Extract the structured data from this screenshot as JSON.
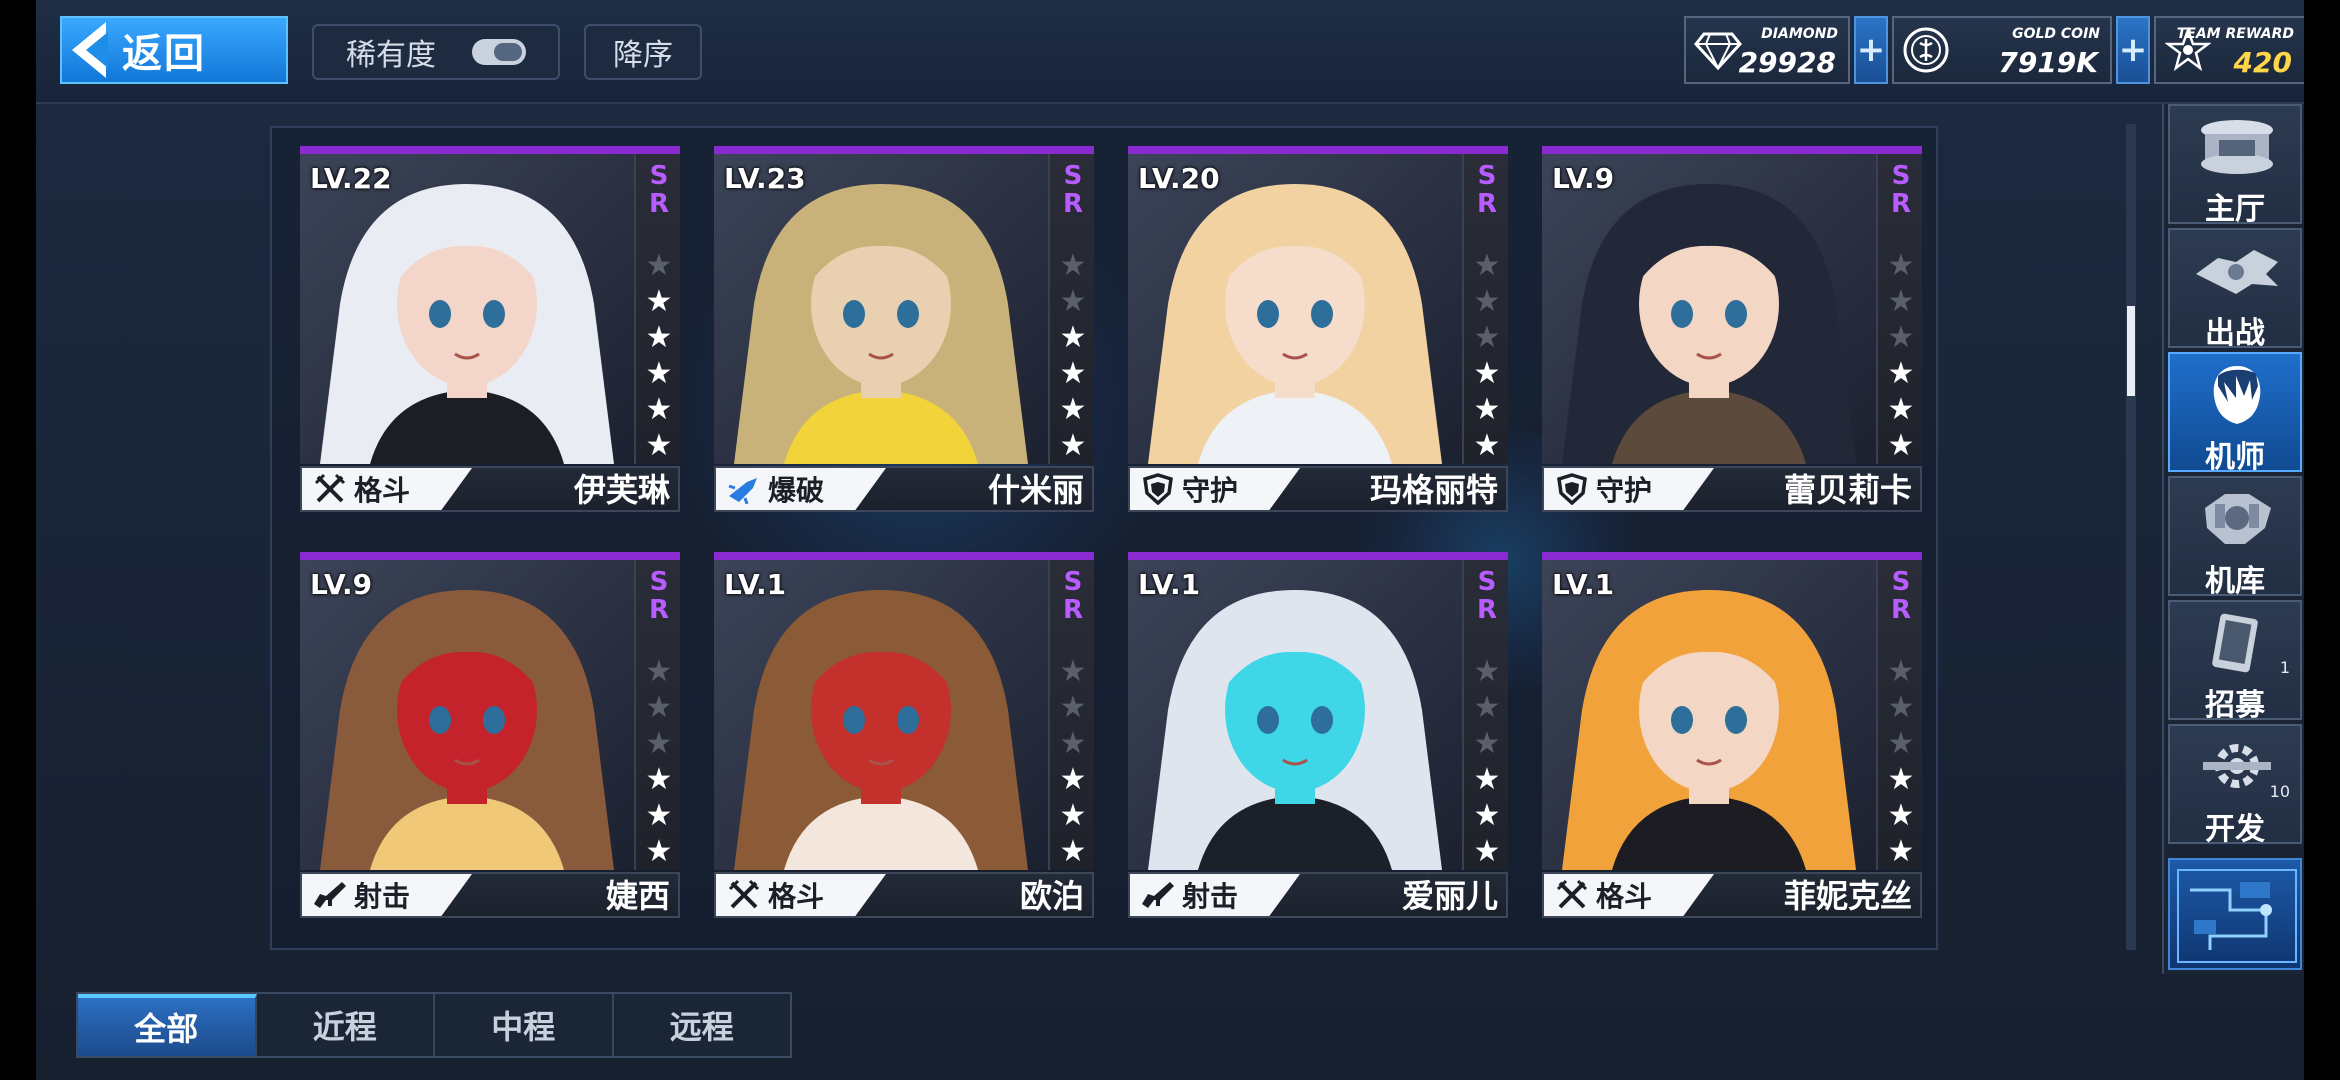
{
  "header": {
    "back_label": "返回",
    "sort_rarity_label": "稀有度",
    "sort_order_label": "降序"
  },
  "currencies": [
    {
      "label": "DIAMOND",
      "value": "29928",
      "icon": "diamond-icon"
    },
    {
      "label": "GOLD COIN",
      "value": "7919K",
      "icon": "gold-coin-icon"
    },
    {
      "label": "TEAM REWARD",
      "value": "420",
      "icon": "team-reward-icon"
    }
  ],
  "cards": [
    {
      "level": "LV.22",
      "rarity": "SR",
      "stars_on": 5,
      "role": "格斗",
      "role_icon": "swords-icon",
      "name": "伊芙琳",
      "palette": [
        "#e9ecf2",
        "#1c1e24",
        "#f3d5c9"
      ]
    },
    {
      "level": "LV.23",
      "rarity": "SR",
      "stars_on": 4,
      "role": "爆破",
      "role_icon": "missile-icon",
      "name": "什米丽",
      "palette": [
        "#c9b27a",
        "#f2d43a",
        "#e8d0b0"
      ]
    },
    {
      "level": "LV.20",
      "rarity": "SR",
      "stars_on": 3,
      "role": "守护",
      "role_icon": "shield-icon",
      "name": "玛格丽特",
      "palette": [
        "#f1d2a0",
        "#eef1f6",
        "#f5dccb"
      ]
    },
    {
      "level": "LV.9",
      "rarity": "SR",
      "stars_on": 3,
      "role": "守护",
      "role_icon": "shield-icon",
      "name": "蕾贝莉卡",
      "palette": [
        "#232838",
        "#5c4a3c",
        "#f3d6c4"
      ]
    },
    {
      "level": "LV.9",
      "rarity": "SR",
      "stars_on": 3,
      "role": "射击",
      "role_icon": "rifle-icon",
      "name": "婕西",
      "palette": [
        "#8a5a3c",
        "#f0c878",
        "#c4232b"
      ]
    },
    {
      "level": "LV.1",
      "rarity": "SR",
      "stars_on": 3,
      "role": "格斗",
      "role_icon": "swords-icon",
      "name": "欧泊",
      "palette": [
        "#8b5a36",
        "#f3e6dc",
        "#c4302b"
      ]
    },
    {
      "level": "LV.1",
      "rarity": "SR",
      "stars_on": 3,
      "role": "射击",
      "role_icon": "rifle-icon",
      "name": "爱丽儿",
      "palette": [
        "#dfe5ee",
        "#1c2028",
        "#3fd6e8"
      ]
    },
    {
      "level": "LV.1",
      "rarity": "SR",
      "stars_on": 3,
      "role": "格斗",
      "role_icon": "swords-icon",
      "name": "菲妮克丝",
      "palette": [
        "#f2a23a",
        "#1c1c22",
        "#f3d6c4"
      ]
    }
  ],
  "nav": [
    {
      "label": "主厅",
      "icon": "lobby-icon",
      "badge": ""
    },
    {
      "label": "出战",
      "icon": "sortie-icon",
      "badge": ""
    },
    {
      "label": "机师",
      "icon": "pilot-icon",
      "badge": "",
      "active": true
    },
    {
      "label": "机库",
      "icon": "hangar-icon",
      "badge": ""
    },
    {
      "label": "招募",
      "icon": "recruit-icon",
      "badge": "1"
    },
    {
      "label": "开发",
      "icon": "develop-icon",
      "badge": "10"
    }
  ],
  "tabs": [
    {
      "label": "全部",
      "active": true
    },
    {
      "label": "近程",
      "active": false
    },
    {
      "label": "中程",
      "active": false
    },
    {
      "label": "远程",
      "active": false
    }
  ],
  "colors": {
    "accent": "#1e8ee8",
    "rarity": "#b85cff",
    "card_top": "#8a2bd1",
    "gold": "#ffd54a"
  }
}
